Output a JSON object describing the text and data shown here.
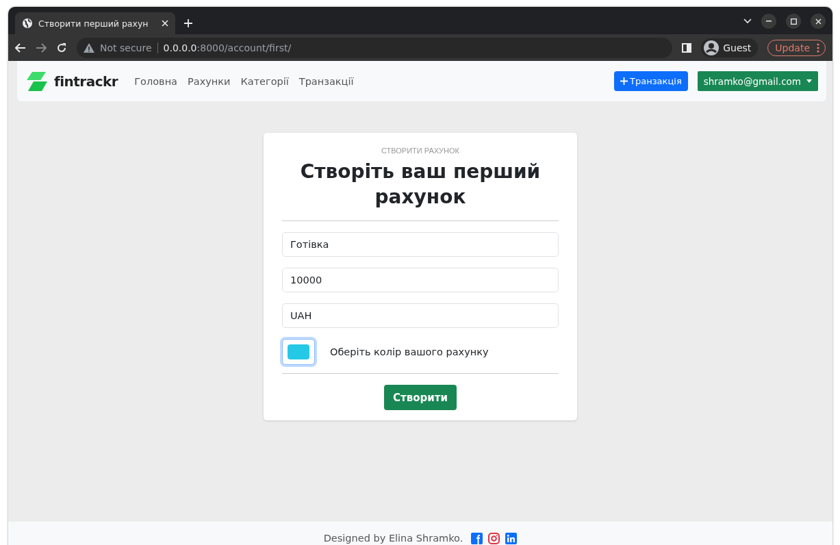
{
  "browser": {
    "tab": {
      "title": "Створити перший рахун",
      "selected": true
    },
    "url_host": "0.0.0.0",
    "url_path": ":8000/account/first/",
    "security": "Not secure",
    "profile": "Guest",
    "update": "Update"
  },
  "navbar": {
    "brand": "fintrackr",
    "links": [
      {
        "label": "Головна"
      },
      {
        "label": "Рахунки"
      },
      {
        "label": "Категорії"
      },
      {
        "label": "Транзакції"
      }
    ],
    "add_button": "Транзакція",
    "user_menu": "shramko@gmail.com"
  },
  "form": {
    "eyebrow": "СТВОРИТИ РАХУНОК",
    "title": "Створіть ваш перший рахунок",
    "fields": [
      {
        "value": "Готівка"
      },
      {
        "value": "10000"
      },
      {
        "value": "UAH"
      }
    ],
    "color_picker": {
      "color": "#25c9e6",
      "label": "Оберіть колір вашого рахунку",
      "focused": true
    },
    "submit": "Створити"
  },
  "footer": {
    "text": "Designed by Elina Shramko."
  }
}
